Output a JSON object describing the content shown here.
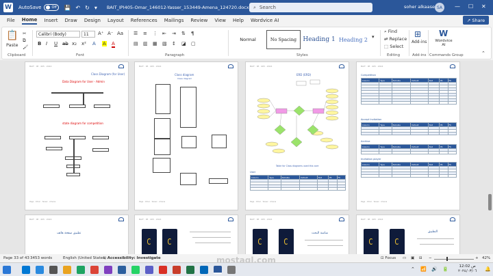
{
  "titlebar": {
    "autosave_label": "AutoSave",
    "autosave_state": "Off",
    "document_title": "BAIT_IPI405-Omar_146012-Yasser_153449-Amena_124720.docx • Saved",
    "search_placeholder": "Search",
    "user_name": "soher alkaasem",
    "user_initials": "SA",
    "minimize": "—",
    "maximize": "☐",
    "close": "✕"
  },
  "menu": {
    "items": [
      "File",
      "Home",
      "Insert",
      "Draw",
      "Design",
      "Layout",
      "References",
      "Mailings",
      "Review",
      "View",
      "Help",
      "Wordvice AI"
    ],
    "active": "Home",
    "share_label": "Share"
  },
  "ribbon": {
    "clipboard": {
      "paste_label": "Paste",
      "group_label": "Clipboard"
    },
    "font": {
      "font_name": "Calibri (Body)",
      "font_size": "11",
      "group_label": "Font",
      "buttons": [
        "B",
        "I",
        "U",
        "ab",
        "x₂",
        "x²",
        "A",
        "A",
        "A"
      ]
    },
    "paragraph": {
      "group_label": "Paragraph"
    },
    "styles": {
      "items": [
        "Normal",
        "No Spacing",
        "Heading 1",
        "Heading 2"
      ],
      "group_label": "Styles"
    },
    "editing": {
      "find_label": "Find",
      "replace_label": "Replace",
      "select_label": "Select",
      "group_label": "Editing"
    },
    "addins": {
      "label": "Add-ins",
      "group_label": "Add-ins"
    },
    "wordvice": {
      "label": "Wordvice AI",
      "group_label": "Commands Group"
    }
  },
  "pages": {
    "header_text": "BAIT · IPI · 405 · 2024",
    "footer_text": "Page · Omar · Yasser · Amena",
    "p1": {
      "title": "Class Diagram (for User)",
      "sub1": "Data Diagram for User - Admin",
      "sub2": "state diagram for competition"
    },
    "p2": {
      "title": "Class diagram",
      "sub": "Class diagram"
    },
    "p3": {
      "title": "ERD (ERD)",
      "caption": "Table for Class diagrams used this core",
      "table_title": "User"
    },
    "p4": {
      "t1": "Competition",
      "t2": "Accept Invitation",
      "t3": "Archive",
      "t4": "Invitation player"
    },
    "p5": {
      "title": "تطبيق صفحة هاتف"
    },
    "p7": {
      "title": "شاشة البحث"
    },
    "p8": {
      "title": "التطبيق"
    }
  },
  "status": {
    "page": "Page 33 of 43",
    "words": "3453 words",
    "language": "English (United States)",
    "accessibility": "Accessibility: Investigate",
    "focus": "Focus",
    "zoom": "42%"
  },
  "taskbar": {
    "time": "12:02",
    "period": "ص",
    "date": "٢٠٢٤/٠٣/٠٦"
  },
  "watermark": "mostaql.com",
  "colors": {
    "accent": "#2b579a",
    "red_text": "#d00000"
  }
}
